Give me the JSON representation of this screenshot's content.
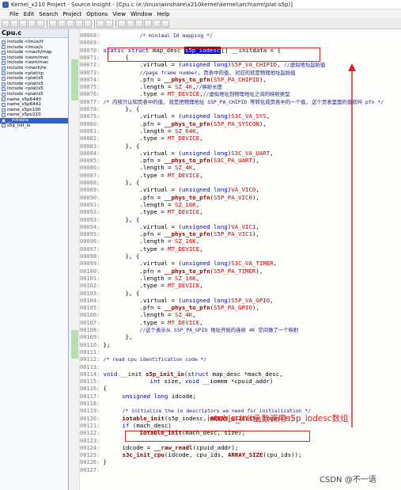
{
  "window": {
    "title": "Kernel_x210 Project - Source Insight - [Cpu.c (e:\\linux\\winshare\\x210kernel\\kernel\\arch\\arm\\plat-s5p)]"
  },
  "menu": [
    "File",
    "Edit",
    "Search",
    "Project",
    "Options",
    "View",
    "Window",
    "Help"
  ],
  "toolbar": {
    "icons": [
      "new-file-icon",
      "open-folder-icon",
      "save-icon",
      "save-all-icon",
      "print-icon",
      "undo-icon",
      "redo-icon",
      "cut-icon",
      "copy-icon",
      "paste-icon",
      "find-icon",
      "replace-icon",
      "back-icon",
      "forward-icon",
      "browse-icon",
      "symbol-icon",
      "jump-icon",
      "bookmark-icon"
    ]
  },
  "sidebar": {
    "title": "Cpu.c",
    "items": [
      "include <linux/ir",
      "include <linux/s",
      "include <mach/map",
      "include <asm/mac",
      "include <asm/mac",
      "include <mach/re",
      "include <plat/cp",
      "include <plat/s5",
      "include <plat/s5",
      "include <plat/s5",
      "include <plat/s5",
      "name_s5p6440",
      "name_s5p6442",
      "name_s5pc100",
      "name_s5pv210",
      "__initdata",
      "s5p_init_io"
    ],
    "selected_index": 15
  },
  "code": {
    "lines": [
      {
        "n": "00068",
        "t": "/* minimal IO mapping */"
      },
      {
        "n": "00069",
        "t": ""
      },
      {
        "n": "00070",
        "t": "static struct map_desc s5p_iodesc[] __initdata = {"
      },
      {
        "n": "00071",
        "t": "{"
      },
      {
        "n": "00072",
        "t": ".virtual = (unsigned long)S5P_VA_CHIPID, //虚拟地址起始值"
      },
      {
        "n": "00073",
        "t": "//page frame number, 页表中的值, 对应的就是物理地址起始值"
      },
      {
        "n": "00074",
        "t": ".pfn = __phys_to_pfn(S5P_PA_CHIPID),"
      },
      {
        "n": "00075",
        "t": ".length = SZ_4K,//映射长度"
      },
      {
        "n": "00076",
        "t": ".type = MT_DEVICE,//虚拟地址到物理地址之间的映射类型"
      },
      {
        "n": "00077",
        "t": "/* 内核只认知页表中的值, 就是把物理地址 S5P_PA_CHIPID 等转化成页表中的一个值, 这个页表里面的值就叫 pfn */"
      },
      {
        "n": "00078",
        "t": "}, {"
      },
      {
        "n": "00079",
        "t": ".virtual = (unsigned long)S3C_VA_SYS,"
      },
      {
        "n": "00080",
        "t": ".pfn = __phys_to_pfn(S5P_PA_SYSCON),"
      },
      {
        "n": "00081",
        "t": ".length = SZ_64K,"
      },
      {
        "n": "00082",
        "t": ".type = MT_DEVICE,"
      },
      {
        "n": "00083",
        "t": "}, {"
      },
      {
        "n": "00084",
        "t": ".virtual = (unsigned long)S3C_VA_UART,"
      },
      {
        "n": "00085",
        "t": ".pfn = __phys_to_pfn(S3C_PA_UART),"
      },
      {
        "n": "00086",
        "t": ".length = SZ_4K,"
      },
      {
        "n": "00087",
        "t": ".type = MT_DEVICE,"
      },
      {
        "n": "00088",
        "t": "}, {"
      },
      {
        "n": "00089",
        "t": ".virtual = (unsigned long)VA_VIC0,"
      },
      {
        "n": "00090",
        "t": ".pfn = __phys_to_pfn(S5P_PA_VIC0),"
      },
      {
        "n": "00091",
        "t": ".length = SZ_16K,"
      },
      {
        "n": "00092",
        "t": ".type = MT_DEVICE,"
      },
      {
        "n": "00093",
        "t": "}, {"
      },
      {
        "n": "00094",
        "t": ".virtual = (unsigned long)VA_VIC1,"
      },
      {
        "n": "00095",
        "t": ".pfn = __phys_to_pfn(S5P_PA_VIC1),"
      },
      {
        "n": "00096",
        "t": ".length = SZ_16K,"
      },
      {
        "n": "00097",
        "t": ".type = MT_DEVICE,"
      },
      {
        "n": "00098",
        "t": "}, {"
      },
      {
        "n": "00099",
        "t": ".virtual = (unsigned long)S3C_VA_TIMER,"
      },
      {
        "n": "00100",
        "t": ".pfn = __phys_to_pfn(S5P_PA_TIMER),"
      },
      {
        "n": "00101",
        "t": ".length = SZ_16K,"
      },
      {
        "n": "00102",
        "t": ".type = MT_DEVICE,"
      },
      {
        "n": "00103",
        "t": "}, {"
      },
      {
        "n": "00104",
        "t": ".virtual = (unsigned long)S5P_VA_GPIO,"
      },
      {
        "n": "00105",
        "t": ".pfn = __phys_to_pfn(S5P_PA_GPIO),"
      },
      {
        "n": "00106",
        "t": ".length = SZ_4K,"
      },
      {
        "n": "00107",
        "t": ".type = MT_DEVICE,"
      },
      {
        "n": "00108",
        "t": "//这个表示从 S5P_PA_GPIO 地址开始的连续 4K 空间做了一个映射"
      },
      {
        "n": "00109",
        "t": "},"
      },
      {
        "n": "00110",
        "t": "};"
      },
      {
        "n": "00111",
        "t": ""
      },
      {
        "n": "00112",
        "t": "/* read cpu identification code */"
      },
      {
        "n": "00113",
        "t": ""
      },
      {
        "n": "00114",
        "t": "void __init s5p_init_io(struct map_desc *mach_desc,"
      },
      {
        "n": "00115",
        "t": "int size, void __iomem *cpuid_addr)"
      },
      {
        "n": "00116",
        "t": "{"
      },
      {
        "n": "00117",
        "t": "unsigned long idcode;"
      },
      {
        "n": "00118",
        "t": ""
      },
      {
        "n": "00119",
        "t": "/* initialize the io descriptors we need for initialization */"
      },
      {
        "n": "00120",
        "t": "iotable_init(s5p_iodesc, ARRAY_SIZE(s5p_iodesc));"
      },
      {
        "n": "00121",
        "t": "if (mach_desc)"
      },
      {
        "n": "00122",
        "t": "iotable_init(mach_desc, size);"
      },
      {
        "n": "00123",
        "t": ""
      },
      {
        "n": "00124",
        "t": "idcode = __raw_readl(cpuid_addr);"
      },
      {
        "n": "00125",
        "t": "s3c_init_cpu(idcode, cpu_ids, ARRAY_SIZE(cpu_ids));"
      },
      {
        "n": "00126",
        "t": "}"
      },
      {
        "n": "00127",
        "t": ""
      }
    ]
  },
  "annotation": {
    "text": "iotable_init函数调用s5p_iodesc数组"
  },
  "watermark": {
    "text": "CSDN @不一语"
  },
  "colors": {
    "annotation": "#e32020",
    "keyword": "#0000c8",
    "macro": "#c00000",
    "function": "#8b0000"
  }
}
